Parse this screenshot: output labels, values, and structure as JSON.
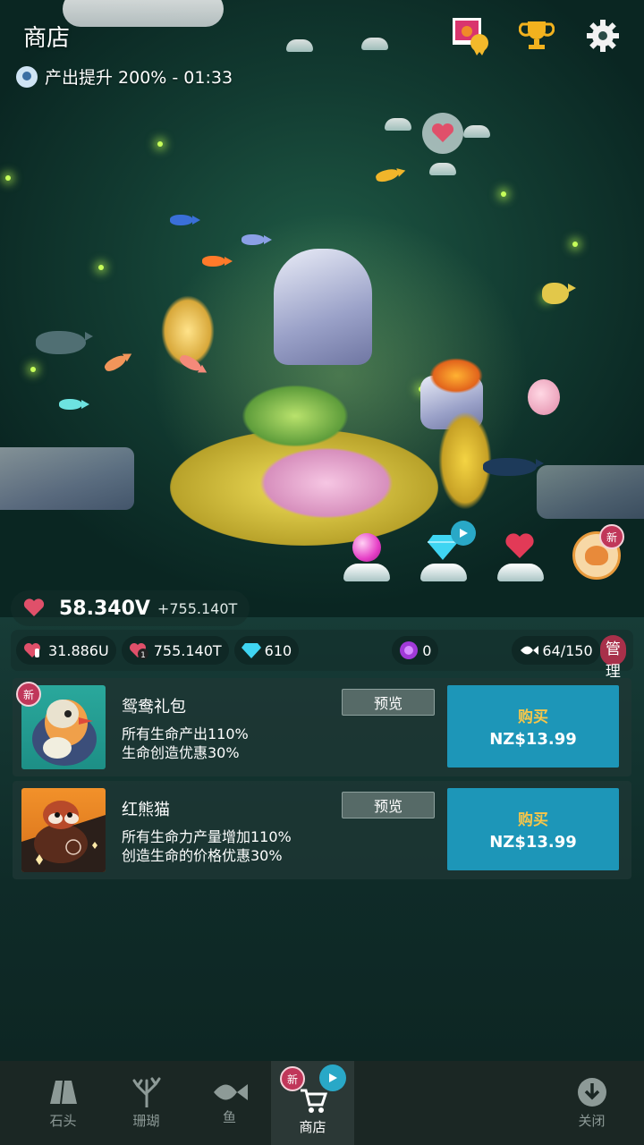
{
  "header": {
    "title": "商店",
    "boost_text": "产出提升 200% - 01:33"
  },
  "stats": {
    "life": "58.340V",
    "life_rate": "+755.140T",
    "tap_value": "31.886U",
    "per_life": "755.140T",
    "gems": "610",
    "pearls": "0",
    "fish_count": "64/150",
    "manage_label": "管理"
  },
  "badges": {
    "new": "新"
  },
  "offers": [
    {
      "name": "鸳鸯礼包",
      "desc1": "所有生命产出110%",
      "desc2": "生命创造优惠30%",
      "preview_label": "预览",
      "buy_label": "购买",
      "price": "NZ$13.99",
      "is_new": true
    },
    {
      "name": "红熊猫",
      "desc1": "所有生命力产量增加110%",
      "desc2": "创造生命的价格优惠30%",
      "preview_label": "预览",
      "buy_label": "购买",
      "price": "NZ$13.99",
      "is_new": false
    }
  ],
  "nav": {
    "items": [
      {
        "label": "石头",
        "icon": "stone-icon"
      },
      {
        "label": "珊瑚",
        "icon": "coral-icon"
      },
      {
        "label": "鱼",
        "icon": "fish-icon"
      },
      {
        "label": "商店",
        "icon": "cart-icon"
      }
    ],
    "close_label": "关闭"
  },
  "colors": {
    "buy_button": "#1d96b8",
    "buy_text": "#f6c64a",
    "manage_button": "#a8304a",
    "new_badge": "#c0375a"
  }
}
